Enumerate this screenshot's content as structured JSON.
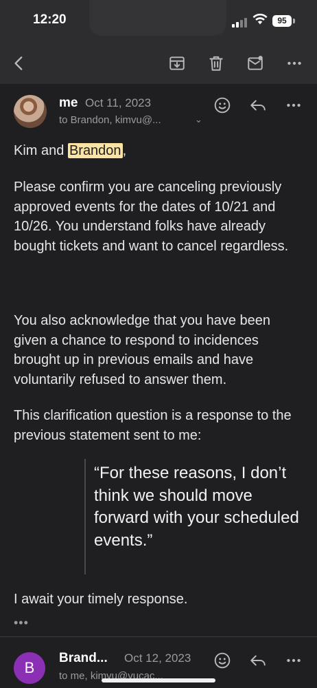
{
  "status": {
    "time": "12:20",
    "battery": "95"
  },
  "toolbar": {
    "back_icon": "chevron-left-icon",
    "archive_icon": "archive-icon",
    "delete_icon": "trash-icon",
    "mark_icon": "mail-unread-icon",
    "more_icon": "more-horizontal-icon"
  },
  "message": {
    "sender": "me",
    "date": "Oct 11, 2023",
    "to": "to Brandon, kimvu@...",
    "greeting_prefix": "Kim and ",
    "greeting_name": "Brandon",
    "greeting_suffix": ",",
    "paragraphs": [
      "Please confirm you are canceling previously approved events for the dates of 10/21 and 10/26. You understand folks have already bought tickets and want to cancel regardless.",
      "You also acknowledge that you have been given a chance to respond to incidences brought up in previous emails and have voluntarily refused to answer them.",
      "This clarification question is a response to the previous statement sent to me:"
    ],
    "quote": "“For these reasons, I don’t think we should move forward with your scheduled events.”",
    "closing": "I await your timely response.",
    "more": "•••"
  },
  "next_message": {
    "avatar_letter": "B",
    "sender": "Brand...",
    "date": "Oct 12, 2023",
    "to": "to me, kimvu@vucac..."
  },
  "colors": {
    "background": "#1f1f21",
    "bar": "#2d2d30",
    "highlight": "#fbe3a3",
    "avatar2": "#8b2fb5"
  }
}
